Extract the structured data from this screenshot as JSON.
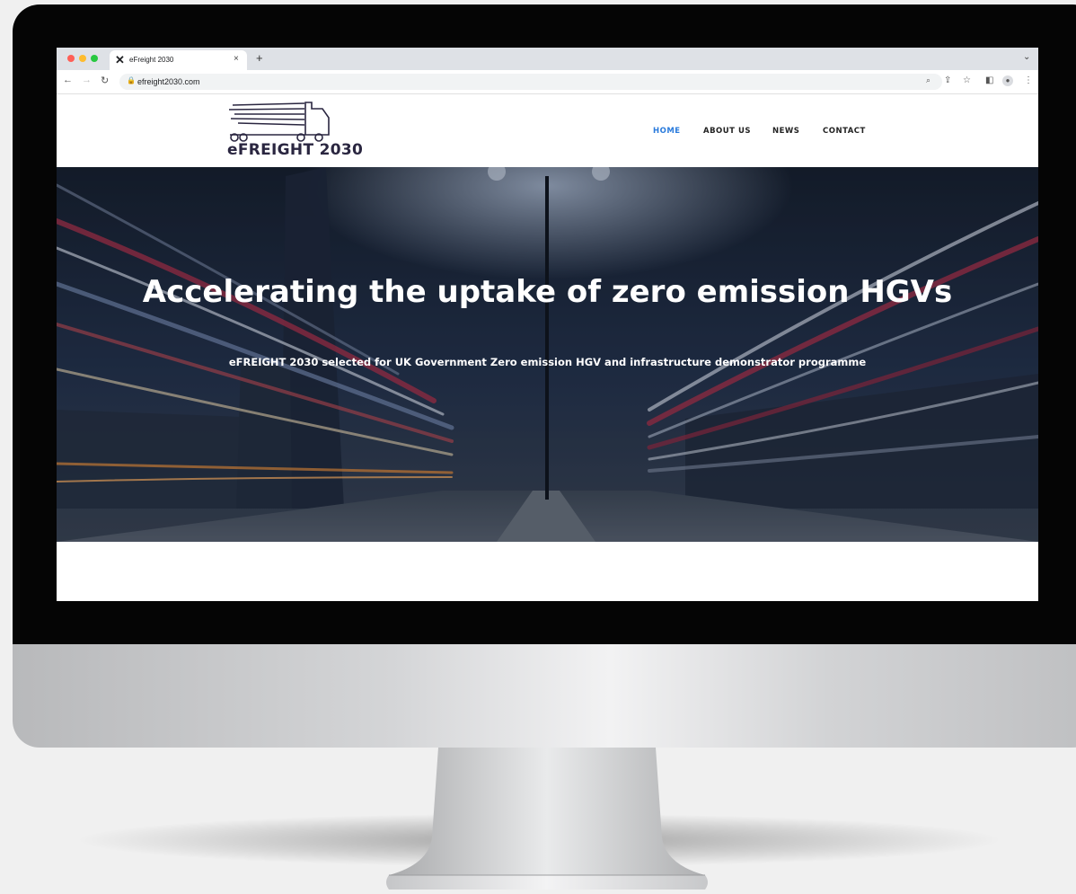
{
  "browser": {
    "tab_title": "eFreight 2030",
    "tab_close": "×",
    "new_tab": "+",
    "url": "efreight2030.com"
  },
  "site": {
    "logo_text": "eFREIGHT 2030",
    "nav": [
      {
        "label": "HOME",
        "active": true
      },
      {
        "label": "ABOUT US",
        "active": false
      },
      {
        "label": "NEWS",
        "active": false
      },
      {
        "label": "CONTACT",
        "active": false
      }
    ],
    "hero": {
      "title": "Accelerating the uptake of zero emission HGVs",
      "subtitle": "eFREIGHT 2030 selected for UK Government Zero emission HGV and infrastructure demonstrator programme"
    }
  },
  "colors": {
    "nav_active": "#2a7bdc",
    "logo": "#2a2640",
    "hero_overlay": "#1b2536"
  }
}
